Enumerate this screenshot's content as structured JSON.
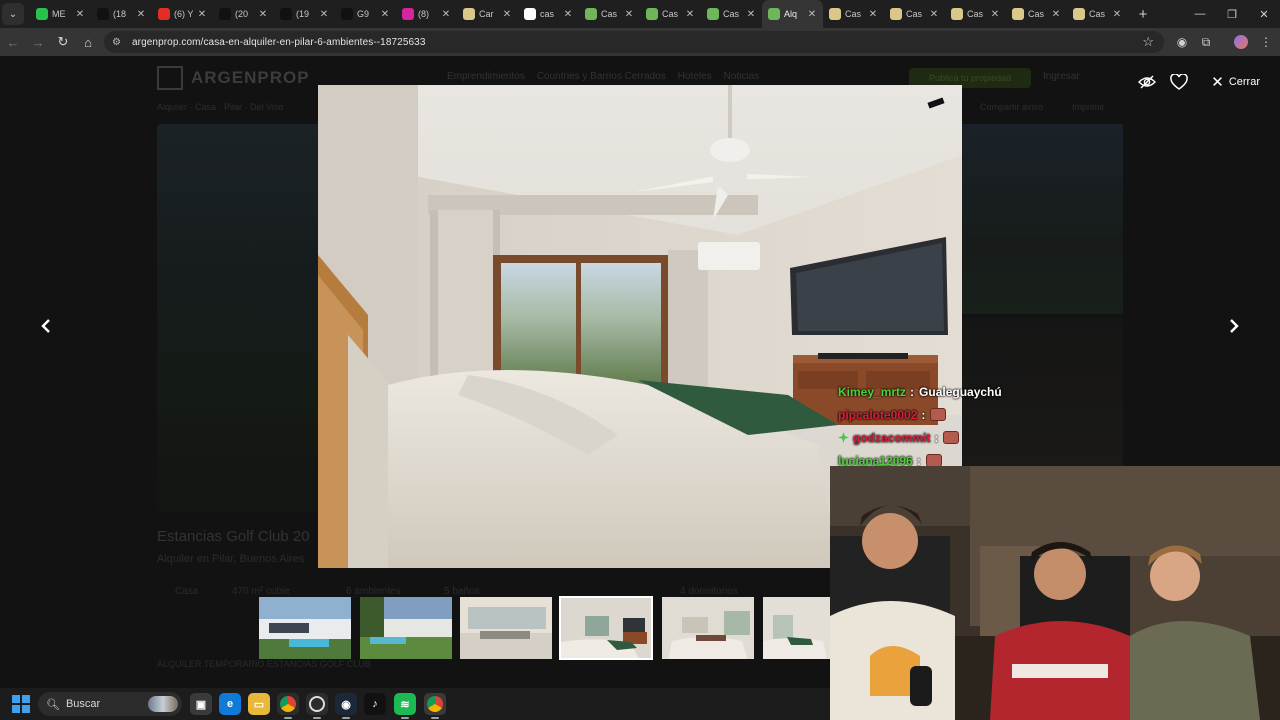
{
  "browser": {
    "tabs": [
      {
        "label": "ME",
        "favicon": "k-icon",
        "color": "#27c24c"
      },
      {
        "label": "(18",
        "favicon": "x-icon",
        "color": "#111111"
      },
      {
        "label": "(6) Y",
        "favicon": "youtube-icon",
        "color": "#e52d27"
      },
      {
        "label": "(20",
        "favicon": "x-icon",
        "color": "#111111"
      },
      {
        "label": "(19",
        "favicon": "x-icon",
        "color": "#111111"
      },
      {
        "label": "G9",
        "favicon": "x-icon",
        "color": "#111111"
      },
      {
        "label": "(8)",
        "favicon": "instagram-icon",
        "color": "#d6249f"
      },
      {
        "label": "Car",
        "favicon": "site-icon",
        "color": "#d9c88a"
      },
      {
        "label": "cas",
        "favicon": "google-icon",
        "color": "#ffffff"
      },
      {
        "label": "Cas",
        "favicon": "argenprop-icon",
        "color": "#6fb55a"
      },
      {
        "label": "Cas",
        "favicon": "argenprop-icon",
        "color": "#6fb55a"
      },
      {
        "label": "Cas",
        "favicon": "argenprop-icon",
        "color": "#6fb55a"
      },
      {
        "label": "Alq",
        "favicon": "argenprop-icon",
        "color": "#6fb55a",
        "active": true
      },
      {
        "label": "Cas",
        "favicon": "site-icon",
        "color": "#d9c88a"
      },
      {
        "label": "Cas",
        "favicon": "site-icon",
        "color": "#d9c88a"
      },
      {
        "label": "Cas",
        "favicon": "site-icon",
        "color": "#d9c88a"
      },
      {
        "label": "Cas",
        "favicon": "site-icon",
        "color": "#d9c88a"
      },
      {
        "label": "Cas",
        "favicon": "site-icon",
        "color": "#d9c88a"
      }
    ],
    "new_tab": "+",
    "url": "argenprop.com/casa-en-alquiler-en-pilar-6-ambientes--18725633"
  },
  "page": {
    "brand": "ARGENPROP",
    "nav": [
      "Emprendimientos",
      "Countries y Barrios Cerrados",
      "Hoteles",
      "Noticias"
    ],
    "cta": "Publicá tu propiedad",
    "login": "Ingresar",
    "breadcrumb": "Alquiler · Casa · Pilar · Del Viso",
    "share": "Compartir aviso",
    "print": "Imprimir",
    "title": "Estancias Golf Club 20",
    "subtitle": "Alquiler en Pilar, Buenos Aires",
    "features": [
      "Casa",
      "470 m² cubie",
      "6 ambientes",
      "5 baños",
      "4 dormitorios"
    ],
    "description": "ALQUILER TEMPORARIO ESTANCIAS GOLF CLUB"
  },
  "lightbox": {
    "close_label": "Cerrar",
    "icons": {
      "hide": "eye-slash-icon",
      "favorite": "heart-icon",
      "prev": "chevron-left-icon",
      "next": "chevron-right-icon"
    },
    "thumb_count": 6,
    "active_thumb": 4
  },
  "stream": {
    "chat": [
      {
        "user": "Kimey_mrtz",
        "color": "#4cd137",
        "message": "Gualeguaychú"
      },
      {
        "user": "pipcalote0002",
        "color": "#d91e3a",
        "message": "",
        "emote": true
      },
      {
        "user": "godzacommit",
        "color": "#d91e3a",
        "message": "",
        "emote": true,
        "badge": true
      },
      {
        "user": "luciana12096",
        "color": "#4cd137",
        "message": "",
        "emote": true
      }
    ]
  },
  "taskbar": {
    "search_label": "Buscar",
    "apps": [
      "task-view-icon",
      "edge-icon",
      "file-explorer-icon",
      "chrome-icon",
      "obs-icon",
      "steam-icon",
      "tiktok-icon",
      "spotify-icon",
      "chrome-profile-icon"
    ]
  }
}
